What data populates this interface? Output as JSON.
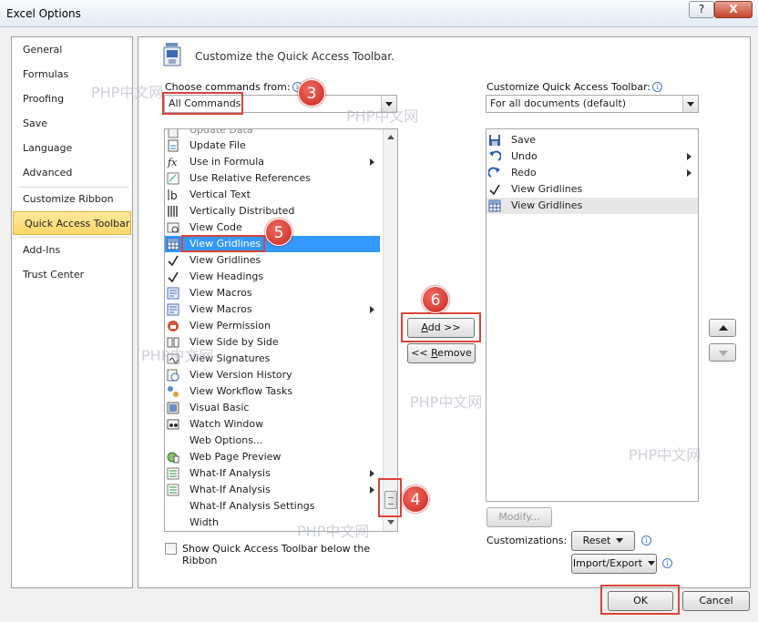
{
  "window": {
    "title": "Excel Options",
    "help_label": "?",
    "close_label": "X"
  },
  "nav": {
    "items": [
      {
        "label": "General"
      },
      {
        "label": "Formulas"
      },
      {
        "label": "Proofing"
      },
      {
        "label": "Save"
      },
      {
        "label": "Language"
      },
      {
        "label": "Advanced"
      },
      {
        "label": "Customize Ribbon"
      },
      {
        "label": "Quick Access Toolbar",
        "selected": true
      },
      {
        "label": "Add-Ins"
      },
      {
        "label": "Trust Center"
      }
    ]
  },
  "header": {
    "title": "Customize the Quick Access Toolbar."
  },
  "left": {
    "choose_label": "Choose commands from:",
    "choose_value": "All Commands",
    "commands": [
      {
        "label": "Update File",
        "icon": "update-file-icon"
      },
      {
        "label": "Use in Formula",
        "icon": "function-icon",
        "submenu": true
      },
      {
        "label": "Use Relative References",
        "icon": "relative-ref-icon"
      },
      {
        "label": "Vertical Text",
        "icon": "vertical-text-icon"
      },
      {
        "label": "Vertically Distributed",
        "icon": "vertical-distribute-icon"
      },
      {
        "label": "View Code",
        "icon": "view-code-icon"
      },
      {
        "label": "View Gridlines",
        "icon": "gridlines-icon",
        "selected": true
      },
      {
        "label": "View Gridlines",
        "icon": "checkmark-icon"
      },
      {
        "label": "View Headings",
        "icon": "checkmark-icon"
      },
      {
        "label": "View Macros",
        "icon": "macros-icon"
      },
      {
        "label": "View Macros",
        "icon": "macros-icon",
        "submenu": true
      },
      {
        "label": "View Permission",
        "icon": "permission-icon"
      },
      {
        "label": "View Side by Side",
        "icon": "side-by-side-icon"
      },
      {
        "label": "View Signatures",
        "icon": "signature-icon"
      },
      {
        "label": "View Version History",
        "icon": "version-history-icon"
      },
      {
        "label": "View Workflow Tasks",
        "icon": "workflow-icon"
      },
      {
        "label": "Visual Basic",
        "icon": "visual-basic-icon"
      },
      {
        "label": "Watch Window",
        "icon": "watch-window-icon"
      },
      {
        "label": "Web Options...",
        "icon": ""
      },
      {
        "label": "Web Page Preview",
        "icon": "web-preview-icon"
      },
      {
        "label": "What-If Analysis",
        "icon": "what-if-icon",
        "submenu": true
      },
      {
        "label": "What-If Analysis",
        "icon": "what-if-icon",
        "submenu": true
      },
      {
        "label": "What-If Analysis Settings",
        "icon": ""
      },
      {
        "label": "Width",
        "icon": ""
      }
    ],
    "show_below_label": "Show Quick Access Toolbar below the Ribbon"
  },
  "center": {
    "add_label": "Add >>",
    "remove_label": "<< Remove"
  },
  "right": {
    "customize_label": "Customize Quick Access Toolbar:",
    "customize_value": "For all documents (default)",
    "items": [
      {
        "label": "Save",
        "icon": "save-icon"
      },
      {
        "label": "Undo",
        "icon": "undo-icon",
        "submenu": true
      },
      {
        "label": "Redo",
        "icon": "redo-icon",
        "submenu": true
      },
      {
        "label": "View Gridlines",
        "icon": "checkmark-icon"
      },
      {
        "label": "View Gridlines",
        "icon": "gridlines-icon",
        "selected": true
      }
    ],
    "modify_label": "Modify...",
    "customizations_label": "Customizations:",
    "reset_label": "Reset",
    "import_export_label": "Import/Export"
  },
  "footer": {
    "ok_label": "OK",
    "cancel_label": "Cancel"
  },
  "annotations": [
    "3",
    "4",
    "5",
    "6"
  ],
  "watermark": "PHP中文网",
  "colors": {
    "selection": "#3399ff",
    "nav_selected": "#fbd66a",
    "callout": "#d9433a"
  }
}
